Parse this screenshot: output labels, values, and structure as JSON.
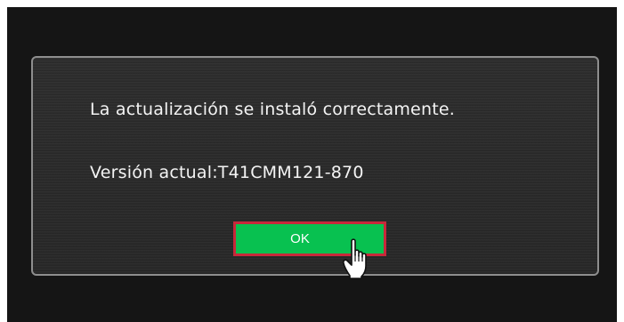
{
  "dialog": {
    "message": "La actualización se instaló correctamente.",
    "version_line": "Versión actual:T41CMM121-870",
    "ok_label": "OK"
  },
  "colors": {
    "screen_background": "#151515",
    "dialog_background": "#2a2a2a",
    "dialog_border": "#8e8e8e",
    "ok_button_fill": "#08c150",
    "ok_button_focus_border": "#c8283a",
    "text": "#f4f4f4"
  },
  "icons": {
    "cursor": "hand-pointer-icon"
  }
}
